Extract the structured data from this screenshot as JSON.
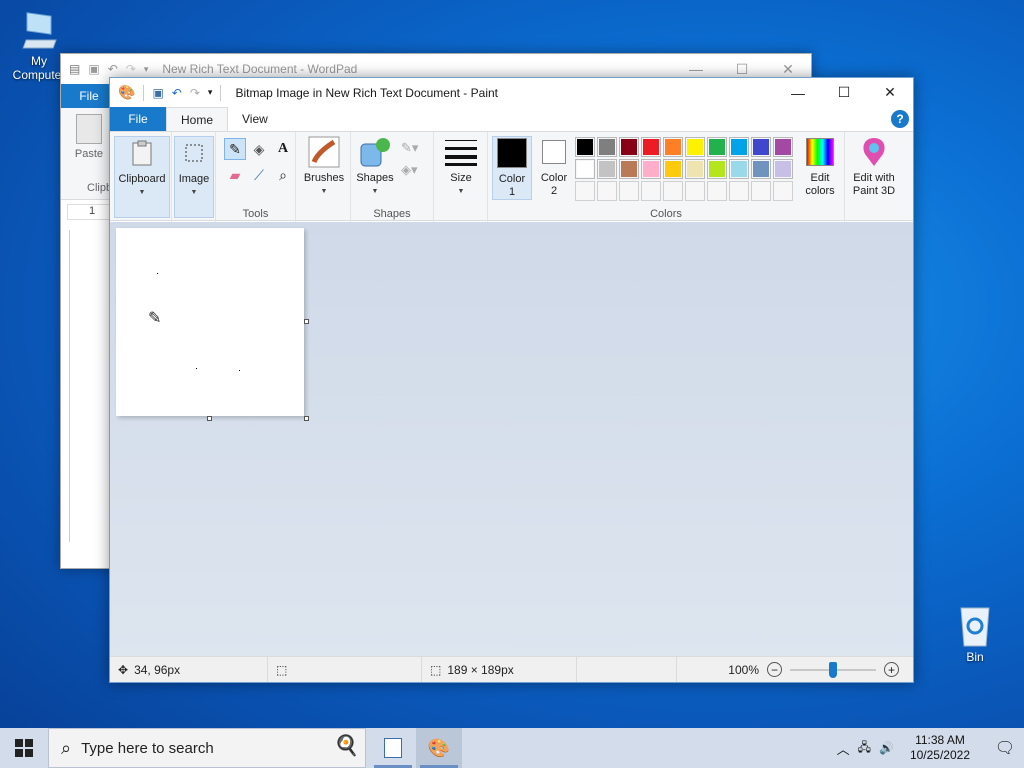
{
  "desktop": {
    "icons": [
      {
        "label": "My Computer",
        "icon": "computer-icon"
      },
      {
        "label": "Bin",
        "icon": "recycle-bin-icon"
      }
    ]
  },
  "wordpad": {
    "title": "New Rich Text Document - WordPad",
    "file_tab": "File",
    "paste_label": "Paste",
    "clipboard_group": "Clipb",
    "ruler_marker": "1"
  },
  "paint": {
    "title": "Bitmap Image in New Rich Text Document - Paint",
    "tabs": {
      "file": "File",
      "home": "Home",
      "view": "View"
    },
    "groups": {
      "clipboard": "Clipboard",
      "image": "Image",
      "tools": "Tools",
      "brushes": "Brushes",
      "shapes": "Shapes",
      "shapes_group": "Shapes",
      "size": "Size",
      "color1_line1": "Color",
      "color1_line2": "1",
      "color2_line1": "Color",
      "color2_line2": "2",
      "edit_colors_line1": "Edit",
      "edit_colors_line2": "colors",
      "colors_group": "Colors",
      "paint3d_line1": "Edit with",
      "paint3d_line2": "Paint 3D"
    },
    "color1": "#000000",
    "color2": "#ffffff",
    "palette": [
      "#000000",
      "#7f7f7f",
      "#880015",
      "#ed1c24",
      "#ff7f27",
      "#fff200",
      "#22b14c",
      "#00a2e8",
      "#3f48cc",
      "#a349a4",
      "#ffffff",
      "#c3c3c3",
      "#b97a57",
      "#ffaec9",
      "#ffc90e",
      "#efe4b0",
      "#b5e61d",
      "#99d9ea",
      "#7092be",
      "#c8bfe7",
      "",
      "",
      "",
      "",
      "",
      "",
      "",
      "",
      "",
      ""
    ],
    "status": {
      "cursor_pos": "34, 96px",
      "image_size": "189 × 189px",
      "zoom": "100%",
      "zoom_level": 0.5
    }
  },
  "taskbar": {
    "search_placeholder": "Type here to search",
    "time": "11:38 AM",
    "date": "10/25/2022"
  }
}
